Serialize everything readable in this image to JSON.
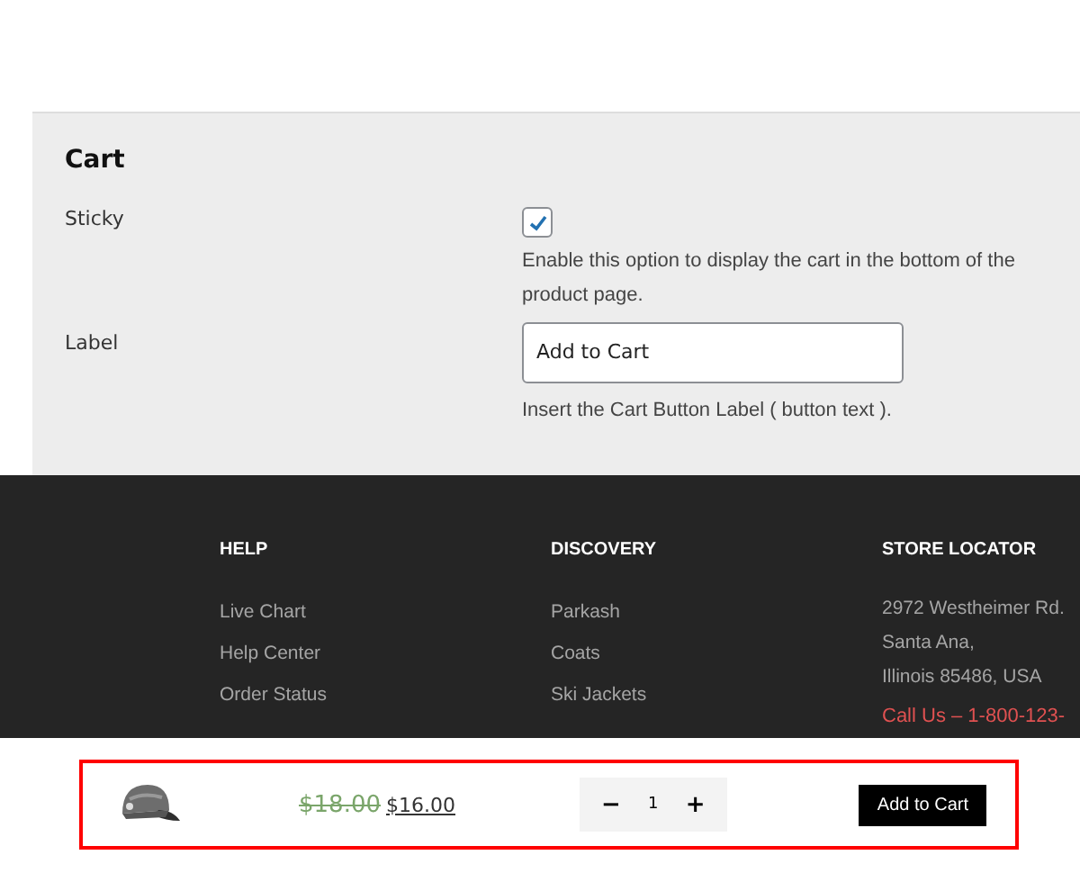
{
  "settings": {
    "title": "Cart",
    "rows": [
      {
        "kind": "checkbox",
        "label": "Sticky",
        "checked": true,
        "help": "Enable this option to display the cart in the bottom of the product page."
      },
      {
        "kind": "text",
        "label": "Label",
        "value": "Add to Cart",
        "help": "Insert the Cart Button Label ( button text )."
      }
    ]
  },
  "footer": {
    "columns": [
      {
        "heading": "HELP",
        "lines": [
          {
            "text": "Live Chart",
            "kind": "link"
          },
          {
            "text": "Help Center",
            "kind": "link"
          },
          {
            "text": "Order Status",
            "kind": "link"
          }
        ]
      },
      {
        "heading": "DISCOVERY",
        "lines": [
          {
            "text": "Parkash",
            "kind": "link"
          },
          {
            "text": "Coats",
            "kind": "link"
          },
          {
            "text": "Ski Jackets",
            "kind": "link"
          }
        ]
      },
      {
        "heading": "STORE LOCATOR",
        "lines": [
          {
            "text": "2972 Westheimer Rd.",
            "kind": "address"
          },
          {
            "text": "Santa Ana,",
            "kind": "address"
          },
          {
            "text": "Illinois 85486, USA",
            "kind": "address"
          },
          {
            "text": "Call Us – 1-800-123-",
            "kind": "phone"
          }
        ]
      }
    ]
  },
  "sticky_cart": {
    "old_price": "$18.00",
    "price": "$16.00",
    "minus": "−",
    "quantity": "1",
    "plus": "+",
    "button": "Add to Cart"
  }
}
